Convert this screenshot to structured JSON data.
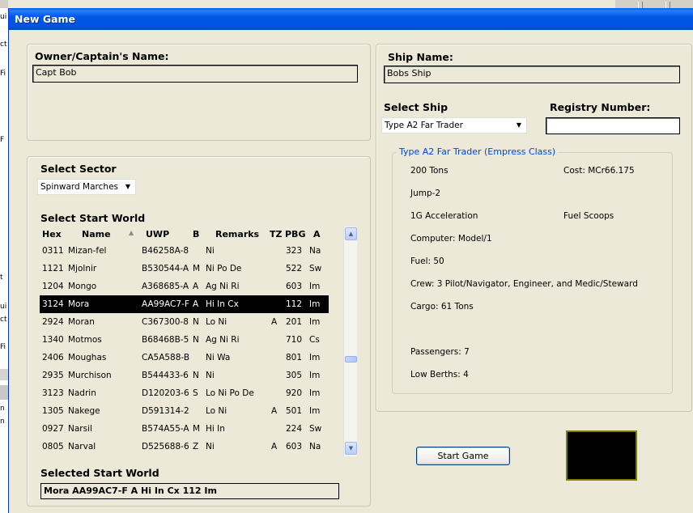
{
  "window": {
    "title": "New Game"
  },
  "owner": {
    "label": "Owner/Captain's Name:",
    "value": "Capt Bob"
  },
  "ship": {
    "name_label": "Ship Name:",
    "name_value": "Bobs Ship",
    "select_label": "Select Ship",
    "selected_ship": "Type A2 Far Trader",
    "registry_label": "Registry Number:",
    "registry_value": ""
  },
  "ship_details": {
    "title": "Type A2 Far Trader  (Empress Class)",
    "tons": "200 Tons",
    "cost": "Cost: MCr66.175",
    "jump": "Jump-2",
    "acceleration": "1G Acceleration",
    "fuel_scoops": "Fuel Scoops",
    "computer": "Computer: Model/1",
    "fuel": "Fuel: 50",
    "crew": "Crew: 3 Pilot/Navigator, Engineer, and Medic/Steward",
    "cargo": "Cargo: 61 Tons",
    "passengers": "Passengers: 7",
    "low_berths": "Low Berths: 4"
  },
  "sector": {
    "label": "Select Sector",
    "selected": "Spinward Marches"
  },
  "worlds": {
    "label": "Select Start World",
    "columns": [
      "Hex",
      "Name",
      "UWP",
      "B",
      "Remarks",
      "TZ",
      "PBG",
      "A"
    ],
    "rows": [
      [
        "0311",
        "Mizan-fel",
        "B46258A-8",
        "",
        "Ni",
        "",
        "323",
        "Na"
      ],
      [
        "1121",
        "Mjolnir",
        "B530544-A",
        "M",
        "Ni Po De",
        "",
        "522",
        "Sw"
      ],
      [
        "1204",
        "Mongo",
        "A368685-A",
        "A",
        "Ag Ni Ri",
        "",
        "603",
        "Im"
      ],
      [
        "3124",
        "Mora",
        "AA99AC7-F",
        "A",
        "Hi In Cx",
        "",
        "112",
        "Im"
      ],
      [
        "2924",
        "Moran",
        "C367300-8",
        "N",
        "Lo Ni",
        "A",
        "201",
        "Im"
      ],
      [
        "1340",
        "Motmos",
        "B68468B-5",
        "N",
        "Ag Ni Ri",
        "",
        "710",
        "Cs"
      ],
      [
        "2406",
        "Moughas",
        "CA5A588-B",
        "",
        "Ni Wa",
        "",
        "801",
        "Im"
      ],
      [
        "2935",
        "Murchison",
        "B544433-6",
        "N",
        "Ni",
        "",
        "305",
        "Im"
      ],
      [
        "3123",
        "Nadrin",
        "D120203-6",
        "S",
        "Lo Ni Po De",
        "",
        "920",
        "Im"
      ],
      [
        "1305",
        "Nakege",
        "D591314-2",
        "",
        "Lo Ni",
        "A",
        "501",
        "Im"
      ],
      [
        "0927",
        "Narsil",
        "B574A55-A",
        "M",
        "Hi In",
        "",
        "224",
        "Sw"
      ],
      [
        "0805",
        "Narval",
        "D525688-6",
        "Z",
        "Ni",
        "A",
        "603",
        "Na"
      ]
    ],
    "selected_index": 3
  },
  "selected_world": {
    "label": "Selected Start World",
    "value": "Mora     AA99AC7-F  A Hi In Cx     112 Im"
  },
  "start_button": "Start Game",
  "background_app": {
    "fragments": [
      "ui",
      "ct",
      "Fi",
      "F",
      "t",
      "ui",
      "ct",
      "Fi",
      "n",
      "n"
    ]
  },
  "icons": {
    "sort": "sort-ascending-icon",
    "dropdown": "chevron-down-icon",
    "scroll_up": "scroll-up-icon",
    "scroll_down": "scroll-down-icon"
  },
  "colors": {
    "title_bar": "#0054e3",
    "window_bg": "#ece9d8",
    "group_title": "#0046d5",
    "selected_row_bg": "#000000"
  }
}
